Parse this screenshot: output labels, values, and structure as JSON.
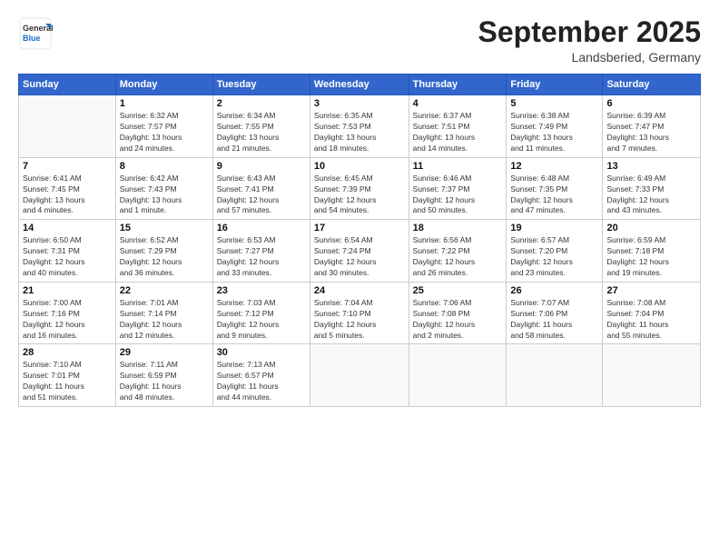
{
  "logo": {
    "general": "General",
    "blue": "Blue"
  },
  "header": {
    "month": "September 2025",
    "location": "Landsberied, Germany"
  },
  "weekdays": [
    "Sunday",
    "Monday",
    "Tuesday",
    "Wednesday",
    "Thursday",
    "Friday",
    "Saturday"
  ],
  "weeks": [
    [
      {
        "day": "",
        "info": ""
      },
      {
        "day": "1",
        "info": "Sunrise: 6:32 AM\nSunset: 7:57 PM\nDaylight: 13 hours\nand 24 minutes."
      },
      {
        "day": "2",
        "info": "Sunrise: 6:34 AM\nSunset: 7:55 PM\nDaylight: 13 hours\nand 21 minutes."
      },
      {
        "day": "3",
        "info": "Sunrise: 6:35 AM\nSunset: 7:53 PM\nDaylight: 13 hours\nand 18 minutes."
      },
      {
        "day": "4",
        "info": "Sunrise: 6:37 AM\nSunset: 7:51 PM\nDaylight: 13 hours\nand 14 minutes."
      },
      {
        "day": "5",
        "info": "Sunrise: 6:38 AM\nSunset: 7:49 PM\nDaylight: 13 hours\nand 11 minutes."
      },
      {
        "day": "6",
        "info": "Sunrise: 6:39 AM\nSunset: 7:47 PM\nDaylight: 13 hours\nand 7 minutes."
      }
    ],
    [
      {
        "day": "7",
        "info": "Sunrise: 6:41 AM\nSunset: 7:45 PM\nDaylight: 13 hours\nand 4 minutes."
      },
      {
        "day": "8",
        "info": "Sunrise: 6:42 AM\nSunset: 7:43 PM\nDaylight: 13 hours\nand 1 minute."
      },
      {
        "day": "9",
        "info": "Sunrise: 6:43 AM\nSunset: 7:41 PM\nDaylight: 12 hours\nand 57 minutes."
      },
      {
        "day": "10",
        "info": "Sunrise: 6:45 AM\nSunset: 7:39 PM\nDaylight: 12 hours\nand 54 minutes."
      },
      {
        "day": "11",
        "info": "Sunrise: 6:46 AM\nSunset: 7:37 PM\nDaylight: 12 hours\nand 50 minutes."
      },
      {
        "day": "12",
        "info": "Sunrise: 6:48 AM\nSunset: 7:35 PM\nDaylight: 12 hours\nand 47 minutes."
      },
      {
        "day": "13",
        "info": "Sunrise: 6:49 AM\nSunset: 7:33 PM\nDaylight: 12 hours\nand 43 minutes."
      }
    ],
    [
      {
        "day": "14",
        "info": "Sunrise: 6:50 AM\nSunset: 7:31 PM\nDaylight: 12 hours\nand 40 minutes."
      },
      {
        "day": "15",
        "info": "Sunrise: 6:52 AM\nSunset: 7:29 PM\nDaylight: 12 hours\nand 36 minutes."
      },
      {
        "day": "16",
        "info": "Sunrise: 6:53 AM\nSunset: 7:27 PM\nDaylight: 12 hours\nand 33 minutes."
      },
      {
        "day": "17",
        "info": "Sunrise: 6:54 AM\nSunset: 7:24 PM\nDaylight: 12 hours\nand 30 minutes."
      },
      {
        "day": "18",
        "info": "Sunrise: 6:56 AM\nSunset: 7:22 PM\nDaylight: 12 hours\nand 26 minutes."
      },
      {
        "day": "19",
        "info": "Sunrise: 6:57 AM\nSunset: 7:20 PM\nDaylight: 12 hours\nand 23 minutes."
      },
      {
        "day": "20",
        "info": "Sunrise: 6:59 AM\nSunset: 7:18 PM\nDaylight: 12 hours\nand 19 minutes."
      }
    ],
    [
      {
        "day": "21",
        "info": "Sunrise: 7:00 AM\nSunset: 7:16 PM\nDaylight: 12 hours\nand 16 minutes."
      },
      {
        "day": "22",
        "info": "Sunrise: 7:01 AM\nSunset: 7:14 PM\nDaylight: 12 hours\nand 12 minutes."
      },
      {
        "day": "23",
        "info": "Sunrise: 7:03 AM\nSunset: 7:12 PM\nDaylight: 12 hours\nand 9 minutes."
      },
      {
        "day": "24",
        "info": "Sunrise: 7:04 AM\nSunset: 7:10 PM\nDaylight: 12 hours\nand 5 minutes."
      },
      {
        "day": "25",
        "info": "Sunrise: 7:06 AM\nSunset: 7:08 PM\nDaylight: 12 hours\nand 2 minutes."
      },
      {
        "day": "26",
        "info": "Sunrise: 7:07 AM\nSunset: 7:06 PM\nDaylight: 11 hours\nand 58 minutes."
      },
      {
        "day": "27",
        "info": "Sunrise: 7:08 AM\nSunset: 7:04 PM\nDaylight: 11 hours\nand 55 minutes."
      }
    ],
    [
      {
        "day": "28",
        "info": "Sunrise: 7:10 AM\nSunset: 7:01 PM\nDaylight: 11 hours\nand 51 minutes."
      },
      {
        "day": "29",
        "info": "Sunrise: 7:11 AM\nSunset: 6:59 PM\nDaylight: 11 hours\nand 48 minutes."
      },
      {
        "day": "30",
        "info": "Sunrise: 7:13 AM\nSunset: 6:57 PM\nDaylight: 11 hours\nand 44 minutes."
      },
      {
        "day": "",
        "info": ""
      },
      {
        "day": "",
        "info": ""
      },
      {
        "day": "",
        "info": ""
      },
      {
        "day": "",
        "info": ""
      }
    ]
  ]
}
